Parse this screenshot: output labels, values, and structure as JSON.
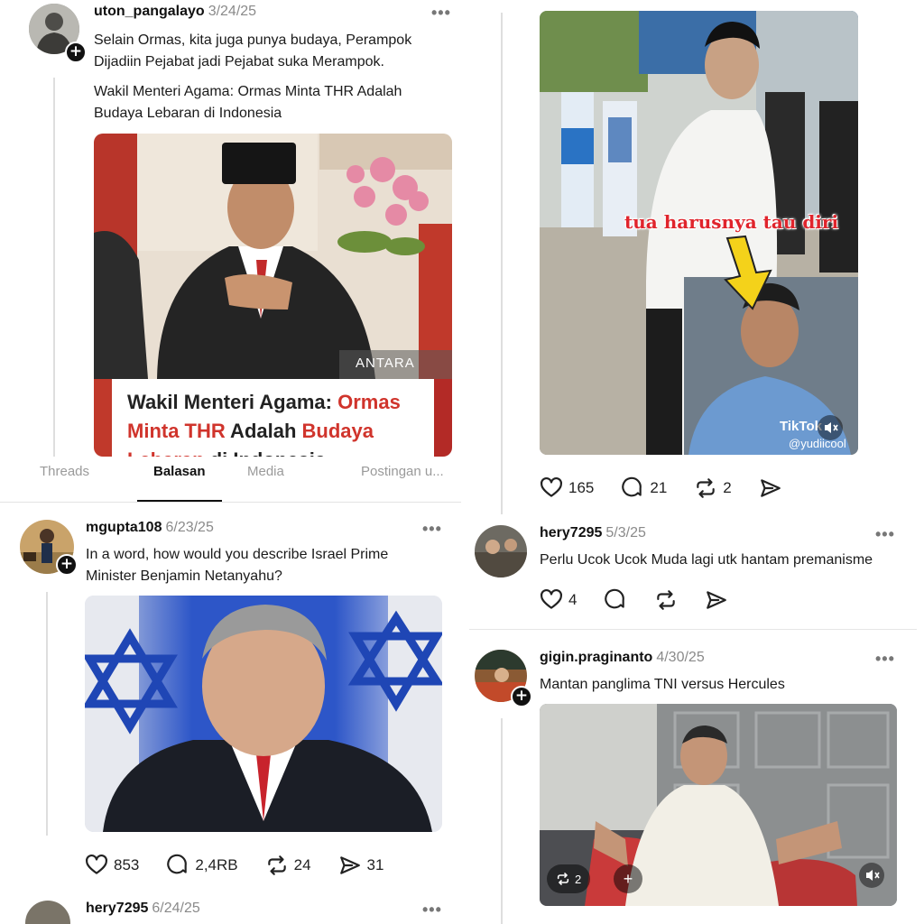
{
  "posts": {
    "uton": {
      "username": "uton_pangalayo",
      "date": "3/24/25",
      "text1": "Selain Ormas, kita juga punya budaya, Perampok",
      "text2": "Dijadiin Pejabat jadi Pejabat suka Merampok.",
      "quote1": "Wakil Menteri Agama: Ormas Minta THR Adalah",
      "quote2": "Budaya Lebaran di Indonesia",
      "card": {
        "watermark": "ANTARA",
        "line1_a": "Wakil Menteri Agama: ",
        "line1_b": "Ormas",
        "line2_a": "Minta THR",
        "line2_b": " Adalah ",
        "line2_c": "Budaya",
        "line3_a": "Lebaran",
        "line3_b": " di Indonesia"
      }
    },
    "video1": {
      "overlay_text": "tua harusnya tau diri",
      "tiktok_handle": "@yudiicool",
      "tiktok_label": "TikTok",
      "stats": {
        "likes": "165",
        "replies": "21",
        "reposts": "2"
      }
    },
    "mgupta": {
      "username": "mgupta108",
      "date": "6/23/25",
      "text1": "In a word, how would you describe Israel Prime",
      "text2": "Minister Benjamin Netanyahu?",
      "stats": {
        "likes": "853",
        "replies": "2,4RB",
        "reposts": "24",
        "shares": "31"
      }
    },
    "hery_bottom": {
      "username": "hery7295",
      "date": "6/24/25"
    },
    "hery": {
      "username": "hery7295",
      "date": "5/3/25",
      "text": "Perlu Ucok Ucok Muda lagi utk hantam premanisme",
      "stats": {
        "likes": "4"
      }
    },
    "gigin": {
      "username": "gigin.praginanto",
      "date": "4/30/25",
      "text": "Mantan panglima TNI versus Hercules",
      "repost_count": "2"
    }
  },
  "tabs": [
    "Threads",
    "Balasan",
    "Media",
    "Postingan u..."
  ],
  "active_tab": "Balasan",
  "colors": {
    "accent_red": "#d0342c",
    "tiktok_red": "#e0242c",
    "text": "#111111",
    "muted": "#8a8a8a"
  }
}
